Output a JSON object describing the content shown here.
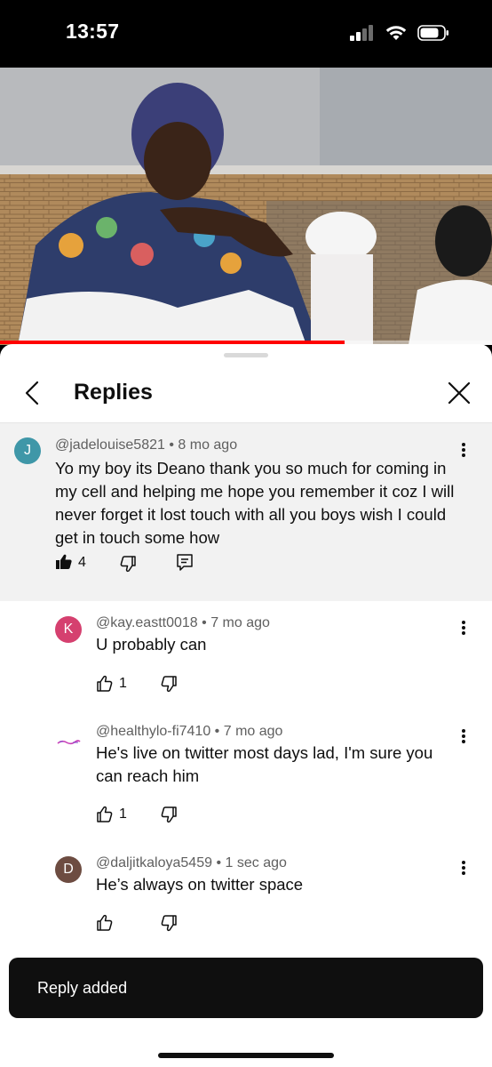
{
  "status_bar": {
    "time": "13:57"
  },
  "video": {
    "progress": 0.7
  },
  "sheet": {
    "title": "Replies"
  },
  "parent_comment": {
    "avatar_letter": "J",
    "avatar_color": "#3f97a8",
    "author": "@jadelouise5821",
    "age": "8 mo ago",
    "text": "Yo my boy its Deano thank you so much for coming in my cell and helping me hope you remember it coz I will never forget it lost touch with all you boys wish I could get in touch some how",
    "likes": "4"
  },
  "replies": [
    {
      "avatar_letter": "K",
      "avatar_color": "#d5406f",
      "author": "@kay.eastt0018",
      "age": "7 mo ago",
      "text": "U probably can",
      "likes": "1"
    },
    {
      "avatar_letter": "",
      "avatar_color": "#ffffff",
      "author": "@healthylo-fi7410",
      "age": "7 mo ago",
      "text": "He's live on twitter most days lad, I'm sure you can reach him",
      "likes": "1"
    },
    {
      "avatar_letter": "D",
      "avatar_color": "#6d4c41",
      "author": "@daljitkaloya5459",
      "age": "1 sec ago",
      "text": "He’s always on twitter space",
      "likes": ""
    }
  ],
  "toast": {
    "text": "Reply added"
  },
  "icons": {
    "back": "chevron-left-icon",
    "close": "close-icon",
    "like": "thumbs-up-icon",
    "dislike": "thumbs-down-icon",
    "reply": "comment-icon",
    "more": "more-vertical-icon"
  }
}
